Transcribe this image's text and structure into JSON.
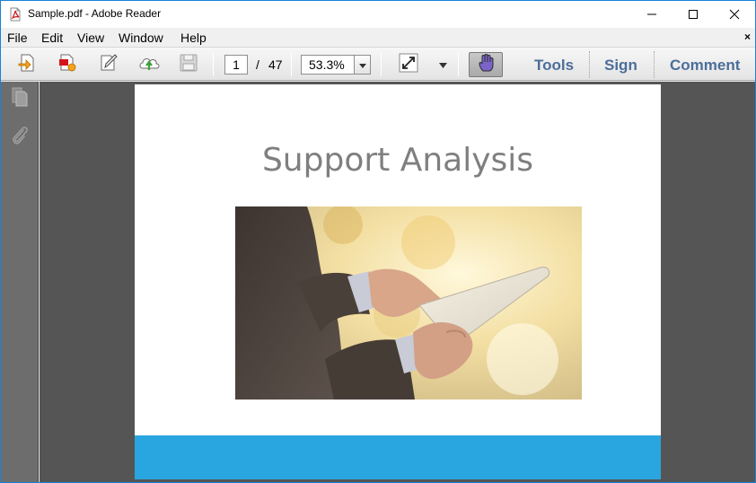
{
  "window": {
    "title": "Sample.pdf - Adobe Reader"
  },
  "menu": {
    "items": [
      "File",
      "Edit",
      "View",
      "Window",
      "Help"
    ],
    "close_glyph": "×"
  },
  "toolbar": {
    "buttons": [
      "open-icon",
      "create-pdf-icon",
      "edit-icon",
      "upload-cloud-icon",
      "save-icon"
    ],
    "page_current": "1",
    "page_separator": "/",
    "page_total": "47",
    "zoom": "53.3%",
    "links": {
      "tools": "Tools",
      "sign": "Sign",
      "comment": "Comment"
    }
  },
  "leftnav": {
    "icons": [
      "pages-icon",
      "attachments-icon"
    ]
  },
  "document": {
    "slide_title": "Support Analysis",
    "accent_color": "#29a6df",
    "title_color": "#7f7f7f"
  }
}
